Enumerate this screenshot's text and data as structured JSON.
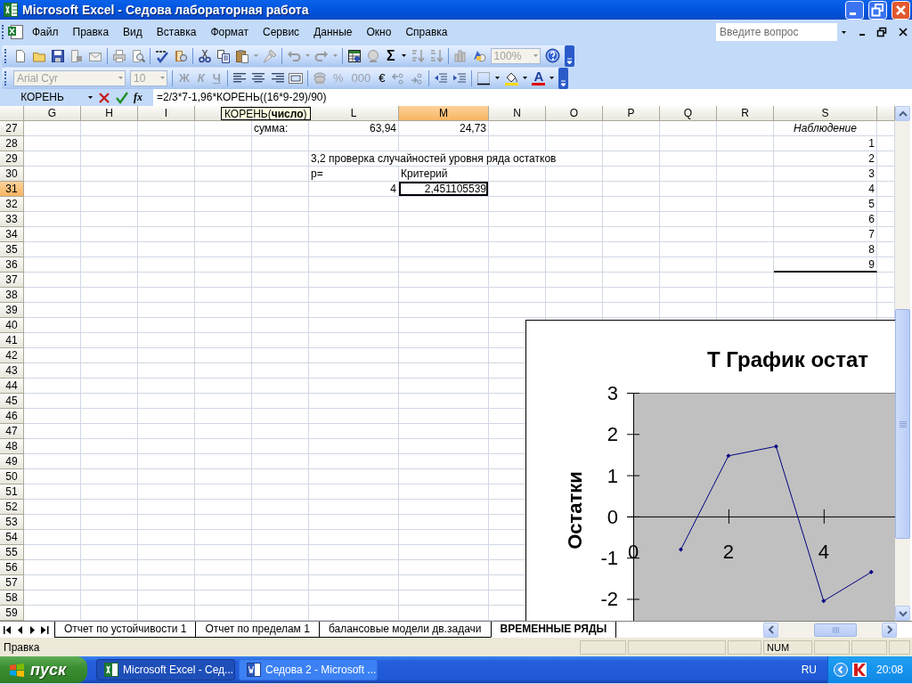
{
  "window": {
    "title": "Microsoft Excel - Седова лабораторная работа"
  },
  "menu": {
    "items": [
      "Файл",
      "Правка",
      "Вид",
      "Вставка",
      "Формат",
      "Сервис",
      "Данные",
      "Окно",
      "Справка"
    ],
    "help_search": {
      "placeholder": "Введите вопрос"
    }
  },
  "toolbar_standard": {
    "autosum": "Σ",
    "zoom": {
      "value": "100%",
      "disabled": true
    }
  },
  "toolbar_formatting": {
    "font": {
      "value": "Arial Cyr",
      "disabled": true
    },
    "size": {
      "value": "10",
      "disabled": true
    },
    "style_buttons": [
      {
        "label": "Ж",
        "kind": "bold",
        "disabled": true
      },
      {
        "label": "К",
        "kind": "italic",
        "disabled": true
      },
      {
        "label": "Ч",
        "kind": "underline",
        "disabled": true
      }
    ],
    "number_buttons": [
      {
        "label": "%",
        "disabled": true
      },
      {
        "label": "000",
        "disabled": true
      },
      {
        "label": "€",
        "disabled": false
      }
    ],
    "font_color": {
      "label": "A"
    }
  },
  "formula_bar": {
    "name_box": "КОРЕНЬ",
    "function_button": "fx",
    "formula": "=2/3*7-1,96*КОРЕНЬ((16*9-29)/90)",
    "tooltip": "КОРЕНЬ(**число**)"
  },
  "grid": {
    "columns": [
      {
        "label": "G",
        "selected": false
      },
      {
        "label": "H",
        "selected": false
      },
      {
        "label": "I",
        "selected": false
      },
      {
        "selected": false
      },
      {
        "selected": false
      },
      {
        "label": "L",
        "selected": false
      },
      {
        "label": "M",
        "selected": true
      },
      {
        "label": "N",
        "selected": false
      },
      {
        "label": "O",
        "selected": false
      },
      {
        "label": "P",
        "selected": false
      },
      {
        "label": "Q",
        "selected": false
      },
      {
        "label": "R",
        "selected": false
      },
      {
        "label": "S",
        "selected": false
      },
      {
        "selected": false
      }
    ],
    "rows": [
      {
        "number": "27",
        "selected": false,
        "cells": {
          "k": {
            "text": "сумма:",
            "kind": "text"
          },
          "l": {
            "text": "63,94",
            "kind": "number"
          },
          "m": {
            "text": "24,73",
            "kind": "number"
          },
          "s": {
            "text": "Наблюдение",
            "kind": "header"
          }
        }
      },
      {
        "number": "28",
        "selected": false,
        "cells": {
          "s": {
            "text": "1",
            "kind": "number"
          }
        }
      },
      {
        "number": "29",
        "selected": false,
        "cells": {
          "l": {
            "text": "3,2 проверка случайностей уровня ряда остатков",
            "kind": "text"
          },
          "s": {
            "text": "2",
            "kind": "number"
          }
        }
      },
      {
        "number": "30",
        "selected": false,
        "cells": {
          "l": {
            "text": "р=",
            "kind": "text"
          },
          "m": {
            "text": "Критерий",
            "kind": "text"
          },
          "s": {
            "text": "3",
            "kind": "number"
          }
        }
      },
      {
        "number": "31",
        "selected": true,
        "cells": {
          "l": {
            "text": "4",
            "kind": "number"
          },
          "m": {
            "text": "2,451105539",
            "kind": "number"
          },
          "s": {
            "text": "4",
            "kind": "number"
          }
        }
      },
      {
        "number": "32",
        "selected": false,
        "cells": {
          "s": {
            "text": "5",
            "kind": "number"
          }
        }
      },
      {
        "number": "33",
        "selected": false,
        "cells": {
          "s": {
            "text": "6",
            "kind": "number"
          }
        }
      },
      {
        "number": "34",
        "selected": false,
        "cells": {
          "s": {
            "text": "7",
            "kind": "number"
          }
        }
      },
      {
        "number": "35",
        "selected": false,
        "cells": {
          "s": {
            "text": "8",
            "kind": "number"
          }
        }
      },
      {
        "number": "36",
        "selected": false,
        "cells": {
          "s": {
            "text": "9",
            "kind": "number",
            "border_bottom": true
          }
        }
      },
      {
        "number": "37",
        "selected": false
      },
      {
        "number": "38",
        "selected": false
      },
      {
        "number": "39",
        "selected": false
      },
      {
        "number": "40",
        "selected": false
      },
      {
        "number": "41",
        "selected": false
      },
      {
        "number": "42",
        "selected": false
      },
      {
        "number": "43",
        "selected": false
      },
      {
        "number": "44",
        "selected": false
      },
      {
        "number": "45",
        "selected": false
      },
      {
        "number": "46",
        "selected": false
      },
      {
        "number": "47",
        "selected": false
      },
      {
        "number": "48",
        "selected": false
      },
      {
        "number": "49",
        "selected": false
      },
      {
        "number": "50",
        "selected": false
      },
      {
        "number": "51",
        "selected": false
      },
      {
        "number": "52",
        "selected": false
      },
      {
        "number": "53",
        "selected": false
      },
      {
        "number": "54",
        "selected": false
      },
      {
        "number": "55",
        "selected": false
      },
      {
        "number": "56",
        "selected": false
      },
      {
        "number": "57",
        "selected": false
      },
      {
        "number": "58",
        "selected": false
      },
      {
        "number": "59",
        "selected": false
      }
    ]
  },
  "chart": {
    "chart_data": {
      "type": "line",
      "title": "Т График остат",
      "ylabel": "Остатки",
      "x": [
        1,
        2,
        3,
        4,
        5
      ],
      "series": [
        {
          "color": "#000080",
          "marker": "diamond",
          "values": [
            -0.8,
            1.47,
            1.7,
            -2.05,
            -1.35
          ]
        }
      ],
      "xticks": [
        0,
        2,
        4
      ],
      "yticks": [
        -2,
        -1,
        0,
        1,
        2,
        3
      ],
      "xlim": [
        0,
        5.5
      ],
      "ylim": [
        -2.53,
        3
      ]
    }
  },
  "sheet_tabs": [
    {
      "label": "Отчет по устойчивости 1",
      "selected": false
    },
    {
      "label": "Отчет по пределам 1",
      "selected": false
    },
    {
      "label": "балансовые модели дв.задачи",
      "selected": false
    },
    {
      "label": "ВРЕМЕННЫЕ РЯДЫ",
      "selected": true
    }
  ],
  "status_bar": {
    "text": "Правка",
    "indicators": [
      "NUM"
    ]
  },
  "taskbar": {
    "start": "пуск",
    "tasks": [
      {
        "label": "Microsoft Excel - Сед...",
        "selected": true
      },
      {
        "label": "Седова 2 - Microsoft ...",
        "selected": false
      }
    ],
    "language": "RU",
    "clock": "20:08"
  }
}
